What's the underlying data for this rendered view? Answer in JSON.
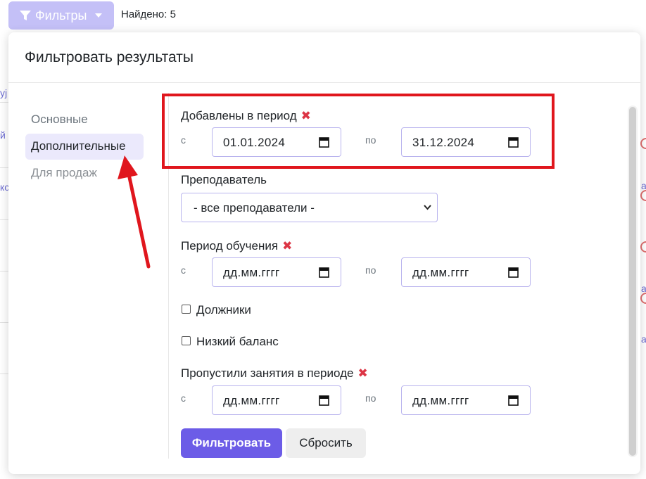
{
  "toolbar": {
    "filters_label": "Фильтры",
    "found_text": "Найдено: 5"
  },
  "background": {
    "left_fragments": [
      "уј",
      "й",
      "кс"
    ],
    "right_fragments": [
      "а",
      "а",
      "а"
    ]
  },
  "panel": {
    "title": "Фильтровать результаты",
    "nav": [
      {
        "label": "Основные",
        "active": false
      },
      {
        "label": "Дополнительные",
        "active": true
      },
      {
        "label": "Для продаж",
        "active": false
      }
    ],
    "added_period": {
      "label": "Добавлены в период",
      "from_label": "с",
      "to_label": "по",
      "from_value": "01.01.2024",
      "to_value": "31.12.2024"
    },
    "teacher": {
      "label": "Преподаватель",
      "selected": "- все преподаватели -"
    },
    "study_period": {
      "label": "Период обучения",
      "from_label": "с",
      "to_label": "по",
      "from_placeholder": "дд.мм.гггг",
      "to_placeholder": "дд.мм.гггг"
    },
    "debtors": {
      "label": "Должники",
      "checked": false
    },
    "low_balance": {
      "label": "Низкий баланс",
      "checked": false
    },
    "missed_period": {
      "label": "Пропустили занятия в периоде",
      "from_label": "с",
      "to_label": "по",
      "from_placeholder": "дд.мм.гггг",
      "to_placeholder": "дд.мм.гггг"
    },
    "buttons": {
      "filter": "Фильтровать",
      "reset": "Сбросить"
    }
  },
  "colors": {
    "accent": "#6c5ce7",
    "highlight": "#e0161d",
    "clear_x": "#dc3545"
  }
}
